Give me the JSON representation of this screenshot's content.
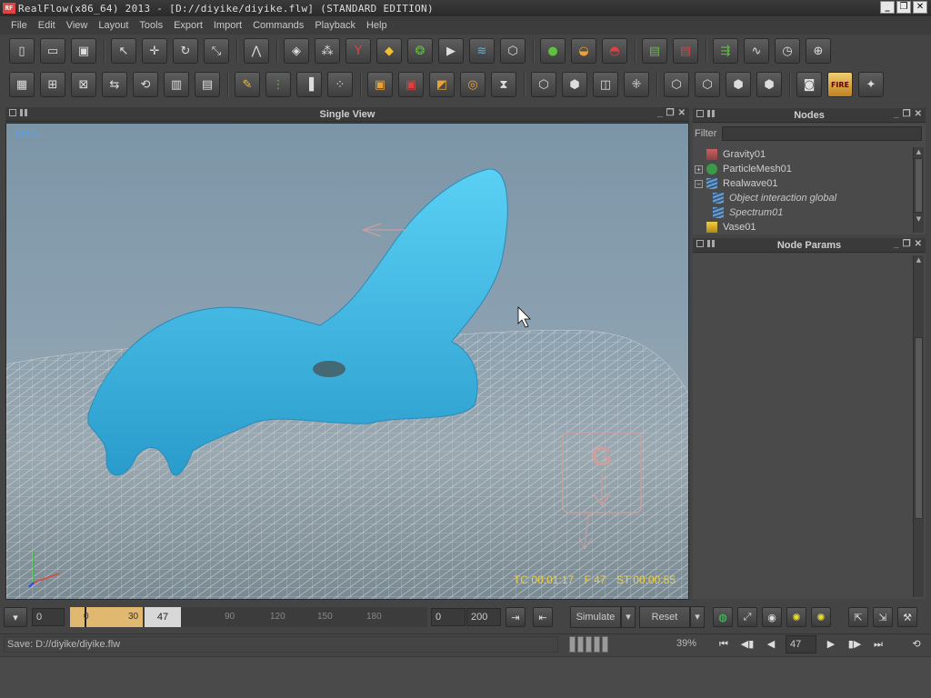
{
  "window": {
    "title": "RealFlow(x86_64) 2013 - [D://diyike/diyike.flw] (STANDARD EDITION)",
    "logo": "RF",
    "minimize": "_",
    "maximize": "❐",
    "close": "✕"
  },
  "menu": [
    "File",
    "Edit",
    "View",
    "Layout",
    "Tools",
    "Export",
    "Import",
    "Commands",
    "Playback",
    "Help"
  ],
  "viewport": {
    "title": "Single View",
    "camera_label": "persp",
    "hud": {
      "tc": "TC 00:01:17",
      "frame": "F 47",
      "st": "ST 00:00:55"
    }
  },
  "nodes": {
    "title": "Nodes",
    "filter_label": "Filter",
    "filter_value": "",
    "items": [
      {
        "label": "Gravity01",
        "expander": "",
        "icon": "gravity-daemon-icon",
        "child": false
      },
      {
        "label": "ParticleMesh01",
        "expander": "+",
        "icon": "particle-mesh-icon",
        "child": false
      },
      {
        "label": "Realwave01",
        "expander": "−",
        "icon": "realwave-icon",
        "child": false
      },
      {
        "label": "Object interaction global",
        "expander": "",
        "icon": "wave-modifier-icon",
        "child": true
      },
      {
        "label": "Spectrum01",
        "expander": "",
        "icon": "spectrum-icon",
        "child": true
      },
      {
        "label": "Vase01",
        "expander": "",
        "icon": "object-cube-icon",
        "child": false
      }
    ]
  },
  "node_params": {
    "title": "Node Params"
  },
  "timeline": {
    "start": "0",
    "current_frame": "47",
    "ticks": [
      "0",
      "30",
      "90",
      "120",
      "150",
      "180"
    ],
    "range_start": "0",
    "range_end": "200",
    "simulate_label": "Simulate",
    "reset_label": "Reset"
  },
  "status": {
    "message": "Save: D://diyike/diyike.flw",
    "percent": "39%",
    "progress": 0.39,
    "frame_field": "47"
  },
  "colors": {
    "fluid": "#3ab8e0",
    "hud_text": "#f0d040",
    "camera_label": "#5aa0e0",
    "timeline_range": "#e0b870"
  }
}
